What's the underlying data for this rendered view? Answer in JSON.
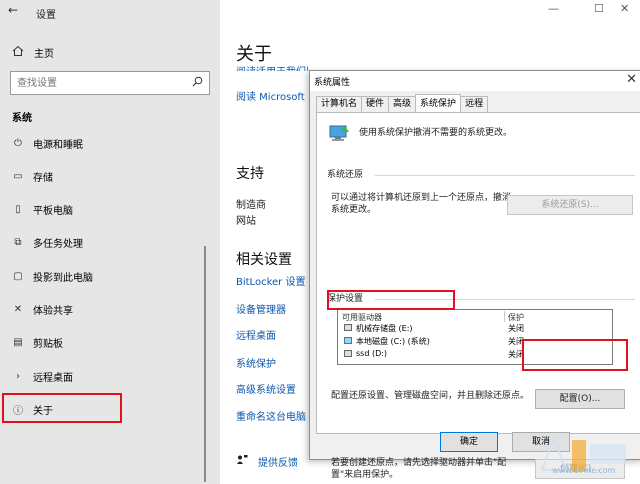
{
  "window": {
    "back": "←",
    "title": "设置",
    "min": "—",
    "max": "☐",
    "close": "✕"
  },
  "sidebar": {
    "home": "主页",
    "search_placeholder": "查找设置",
    "section": "系统",
    "items": [
      {
        "label": "电源和睡眠",
        "icon": "power-icon"
      },
      {
        "label": "存储",
        "icon": "storage-icon"
      },
      {
        "label": "平板电脑",
        "icon": "tablet-icon"
      },
      {
        "label": "多任务处理",
        "icon": "multitasking-icon"
      },
      {
        "label": "投影到此电脑",
        "icon": "projecting-icon"
      },
      {
        "label": "体验共享",
        "icon": "shared-experiences-icon"
      },
      {
        "label": "剪贴板",
        "icon": "clipboard-icon"
      },
      {
        "label": "远程桌面",
        "icon": "remote-desktop-icon"
      },
      {
        "label": "关于",
        "icon": "info-icon"
      }
    ]
  },
  "main": {
    "title": "关于",
    "top_link_1": "阅读适用于我们服务的 Microsoft 服务协议",
    "top_link_2": "阅读 Microsoft 软",
    "support_heading": "支持",
    "manufacturer": "制造商",
    "website": "网站",
    "related_heading": "相关设置",
    "related_links": [
      "BitLocker 设置",
      "设备管理器",
      "远程桌面",
      "系统保护",
      "高级系统设置",
      "重命名这台电脑"
    ],
    "feedback": "提供反馈"
  },
  "dialog": {
    "title": "系统属性",
    "close": "✕",
    "tabs": [
      "计算机名",
      "硬件",
      "高级",
      "系统保护",
      "远程"
    ],
    "active_tab": "系统保护",
    "intro": "使用系统保护撤消不需要的系统更改。",
    "restore_group": "系统还原",
    "restore_desc": "可以通过将计算机还原到上一个还原点，撤消系统更改。",
    "restore_button": "系统还原(S)...",
    "protect_group": "保护设置",
    "drives_header": {
      "name": "可用驱动器",
      "state": "保护"
    },
    "drives": [
      {
        "name": "机械存储盘 (E:)",
        "state": "关闭"
      },
      {
        "name": "本地磁盘 (C:) (系统)",
        "state": "关闭"
      },
      {
        "name": "ssd (D:)",
        "state": "关闭"
      }
    ],
    "config_desc": "配置还原设置、管理磁盘空间，并且删除还原点。",
    "config_button": "配置(O)...",
    "create_desc": "若要创建还原点，请先选择驱动器并单击\"配置\"来启用保护。",
    "create_button": "创建(C)...",
    "ok": "确定",
    "cancel": "取消"
  },
  "watermark": "www.17mc.com",
  "colors": {
    "accent_link": "#0a58ad",
    "highlight": "#e1121f",
    "sidebar_bg": "#e6e6e6"
  }
}
